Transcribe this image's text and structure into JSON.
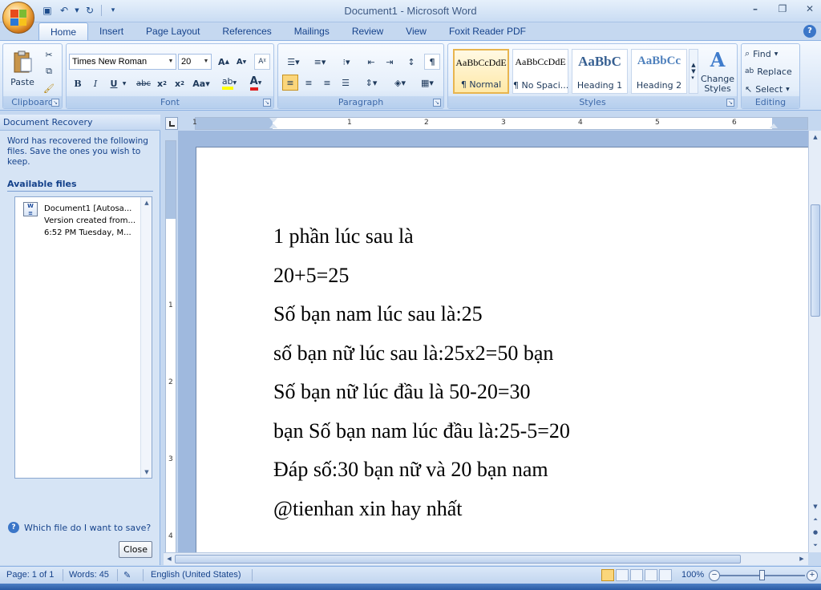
{
  "window": {
    "title": "Document1 - Microsoft Word"
  },
  "colors": {
    "accent": "#15428b",
    "ribbon": "#dde9f8",
    "selected_style": "#ffe9a8"
  },
  "tabs": [
    {
      "label": "Home"
    },
    {
      "label": "Insert"
    },
    {
      "label": "Page Layout"
    },
    {
      "label": "References"
    },
    {
      "label": "Mailings"
    },
    {
      "label": "Review"
    },
    {
      "label": "View"
    },
    {
      "label": "Foxit Reader PDF"
    }
  ],
  "ribbon": {
    "clipboard": {
      "label": "Clipboard",
      "paste": "Paste"
    },
    "font": {
      "label": "Font",
      "family": "Times New Roman",
      "size": "20"
    },
    "paragraph": {
      "label": "Paragraph"
    },
    "styles": {
      "label": "Styles",
      "items": [
        {
          "sample": "AaBbCcDdE",
          "name": "¶ Normal"
        },
        {
          "sample": "AaBbCcDdE",
          "name": "¶ No Spaci..."
        },
        {
          "sample": "AaBbC",
          "name": "Heading 1"
        },
        {
          "sample": "AaBbCc",
          "name": "Heading 2"
        }
      ],
      "change": "Change Styles"
    },
    "editing": {
      "label": "Editing",
      "find": "Find",
      "replace": "Replace",
      "select": "Select"
    }
  },
  "pane": {
    "title": "Document Recovery",
    "message": "Word has recovered the following files.  Save the ones you wish to keep.",
    "available": "Available files",
    "file": {
      "line1": "Document1  [Autosa...",
      "line2": "Version created from...",
      "line3": "6:52 PM Tuesday, M..."
    },
    "help": "Which file do I want to save?",
    "close": "Close"
  },
  "ruler": {
    "numbers": [
      "1",
      "1",
      "2",
      "3",
      "4",
      "5",
      "6"
    ],
    "vnumbers": [
      "1",
      "2",
      "3",
      "4"
    ]
  },
  "document": {
    "lines": [
      "1 phần lúc sau là",
      "20+5=25",
      "Số bạn nam lúc sau là:25",
      " số bạn nữ lúc sau là:25x2=50 bạn",
      " Số bạn nữ lúc đầu là 50-20=30",
      " bạn Số bạn nam lúc đầu là:25-5=20",
      " Đáp số:30 bạn nữ và 20 bạn nam",
      "@tienhan xin hay nhất"
    ]
  },
  "status": {
    "page": "Page: 1 of 1",
    "words": "Words: 45",
    "language": "English (United States)",
    "zoom": "100%"
  }
}
